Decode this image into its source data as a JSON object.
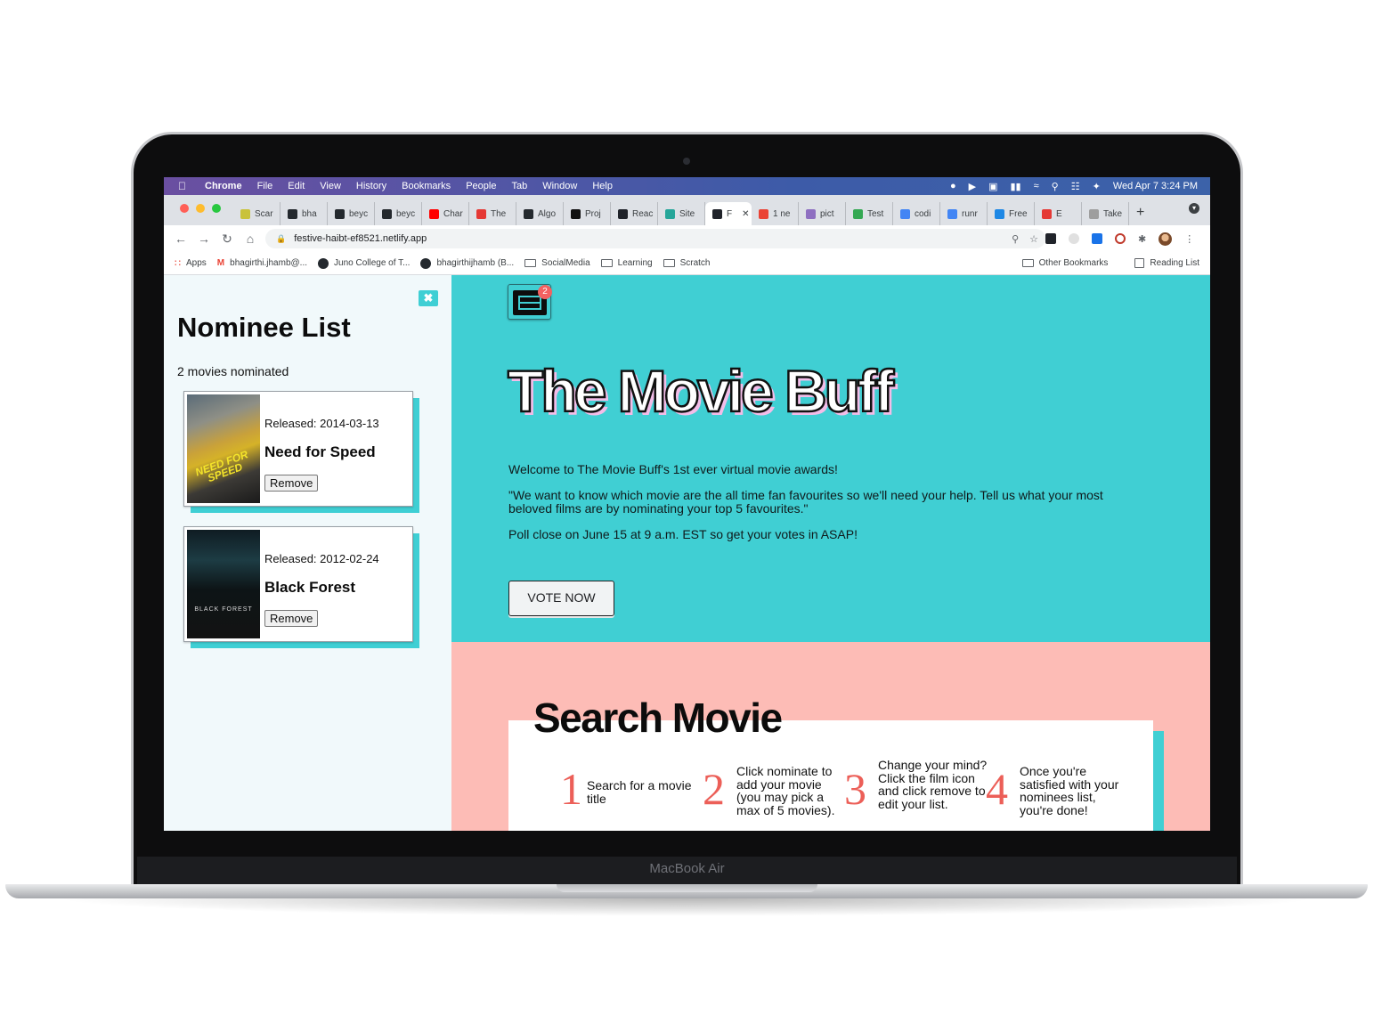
{
  "device": {
    "model_label": "MacBook Air"
  },
  "menubar": {
    "app": "Chrome",
    "items": [
      "File",
      "Edit",
      "View",
      "History",
      "Bookmarks",
      "People",
      "Tab",
      "Window",
      "Help"
    ],
    "clock": "Wed Apr 7  3:24 PM"
  },
  "tabs": [
    {
      "label": "Scar",
      "color": "#c9c23a"
    },
    {
      "label": "bha",
      "color": "#24292e"
    },
    {
      "label": "beyc",
      "color": "#24292e"
    },
    {
      "label": "beyc",
      "color": "#24292e"
    },
    {
      "label": "Char",
      "color": "#ff0000"
    },
    {
      "label": "The",
      "color": "#e53935"
    },
    {
      "label": "Algo",
      "color": "#24292e"
    },
    {
      "label": "Proj",
      "color": "#111111"
    },
    {
      "label": "Reac",
      "color": "#20232a"
    },
    {
      "label": "Site",
      "color": "#26a69a"
    },
    {
      "label": "F",
      "color": "#20232a",
      "active": true
    },
    {
      "label": "1 ne",
      "color": "#ea4335"
    },
    {
      "label": "pict",
      "color": "#8e6fc1"
    },
    {
      "label": "Test",
      "color": "#34a853"
    },
    {
      "label": "codi",
      "color": "#4285f4"
    },
    {
      "label": "runr",
      "color": "#4285f4"
    },
    {
      "label": "Free",
      "color": "#1e88e5"
    },
    {
      "label": "E",
      "color": "#e53935"
    },
    {
      "label": "Take",
      "color": "#9e9e9e"
    }
  ],
  "toolbar": {
    "url": "festive-haibt-ef8521.netlify.app"
  },
  "bookmarks": {
    "left": [
      "Apps",
      "bhagirthi.jhamb@...",
      "Juno College of T...",
      "bhagirthijhamb (B...",
      "SocialMedia",
      "Learning",
      "Scratch"
    ],
    "right": [
      "Other Bookmarks",
      "Reading List"
    ]
  },
  "sidebar": {
    "close_label": "✖",
    "title": "Nominee List",
    "count_text": "2 movies nominated",
    "remove_label": "Remove",
    "nominees": [
      {
        "released": "Released: 2014-03-13",
        "title": "Need for Speed",
        "poster_text": "NEED FOR SPEED"
      },
      {
        "released": "Released: 2012-02-24",
        "title": "Black Forest",
        "poster_text": "BLACK FOREST"
      }
    ]
  },
  "hero": {
    "badge_count": "2",
    "title": "The Movie Buff",
    "paragraphs": [
      "Welcome to The Movie Buff's 1st ever virtual movie awards!",
      "\"We want to know which movie are the all time fan favourites so we'll need your help. Tell us what your most beloved films are by nominating your top 5 favourites.\"",
      "Poll close on June 15 at 9 a.m. EST so get your votes in ASAP!"
    ],
    "vote_label": "VOTE NOW"
  },
  "search": {
    "title": "Search Movie",
    "steps": [
      {
        "num": "1",
        "text": "Search for a movie title"
      },
      {
        "num": "2",
        "text": "Click nominate to add your movie (you may pick a max of 5 movies)."
      },
      {
        "num": "3",
        "text": "Change your mind? Click the film icon and click remove to edit your list."
      },
      {
        "num": "4",
        "text": "Once you're satisfied with your nominees list, you're done!"
      }
    ]
  },
  "colors": {
    "accent_teal": "#40cfd3",
    "section_pink": "#fdbcb6",
    "step_number_red": "#ec5f58",
    "sidebar_bg": "#f1f9fb"
  }
}
